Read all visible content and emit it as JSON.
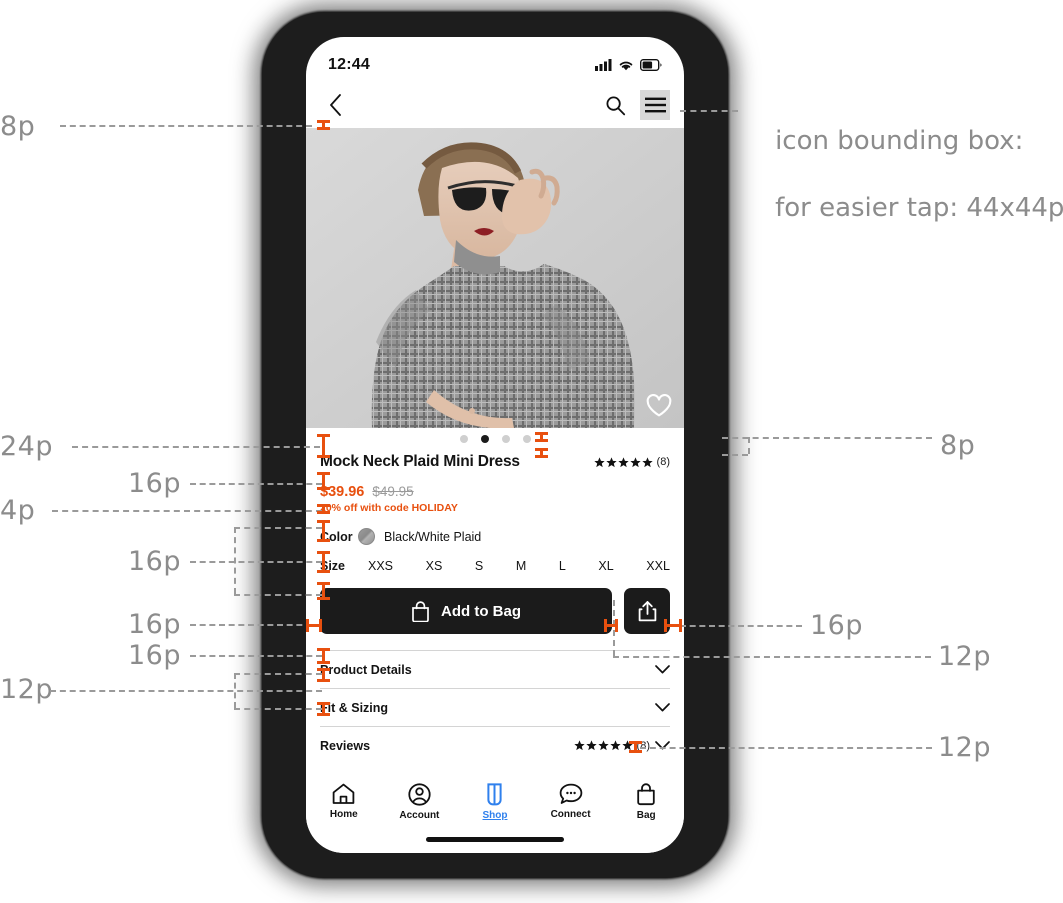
{
  "phone": {
    "status_bar": {
      "time": "12:44",
      "icons": [
        "cellular-signal-icon",
        "wifi-icon",
        "battery-icon"
      ]
    },
    "nav_bar": {
      "back_icon": "chevron-left-icon",
      "search_icon": "search-icon",
      "menu_icon": "hamburger-menu-icon"
    },
    "hero": {
      "favorite_icon": "heart-icon",
      "alt": "Model wearing plaid mock neck mini dress"
    },
    "carousel": {
      "count": 4,
      "active_index": 1
    },
    "product": {
      "title": "Mock Neck Plaid Mini Dress",
      "rating_stars": 5,
      "review_count": "(8)",
      "price_current": "$39.96",
      "price_original": "$49.95",
      "promo": "20% off with code HOLIDAY",
      "color_label": "Color",
      "color_value": "Black/White Plaid",
      "size_label": "Size",
      "sizes": [
        "XXS",
        "XS",
        "S",
        "M",
        "L",
        "XL",
        "XXL"
      ]
    },
    "cta": {
      "add_to_bag_label": "Add to Bag",
      "bag_icon": "shopping-bag-icon",
      "share_icon": "share-icon"
    },
    "accordion": [
      {
        "label": "Product Details",
        "chevron": "chevron-down-icon",
        "has_rating": false
      },
      {
        "label": "Fit & Sizing",
        "chevron": "chevron-down-icon",
        "has_rating": false
      },
      {
        "label": "Reviews",
        "chevron": "chevron-down-icon",
        "has_rating": true,
        "review_count": "(8)"
      }
    ],
    "tab_bar": {
      "active": "Shop",
      "items": [
        {
          "label": "Home",
          "icon": "home-icon"
        },
        {
          "label": "Account",
          "icon": "account-circle-icon"
        },
        {
          "label": "Shop",
          "icon": "dress-icon"
        },
        {
          "label": "Connect",
          "icon": "chat-bubble-icon"
        },
        {
          "label": "Bag",
          "icon": "shopping-bag-icon"
        }
      ]
    }
  },
  "annotations": {
    "left": [
      {
        "id": "a-8p-nav",
        "text": "8p"
      },
      {
        "id": "a-24p",
        "text": "24p"
      },
      {
        "id": "a-16p-title",
        "text": "16p"
      },
      {
        "id": "a-4p",
        "text": "4p"
      },
      {
        "id": "a-16p-color",
        "text": "16p"
      },
      {
        "id": "a-16p-cta",
        "text": "16p"
      },
      {
        "id": "a-16p-acc",
        "text": "16p"
      },
      {
        "id": "a-12p",
        "text": "12p"
      }
    ],
    "right": [
      {
        "id": "b-note",
        "line1": "icon bounding box:",
        "line2": "for easier tap: 44x44p"
      },
      {
        "id": "b-8p",
        "text": "8p"
      },
      {
        "id": "b-16p",
        "text": "16p"
      },
      {
        "id": "b-12p-1",
        "text": "12p"
      },
      {
        "id": "b-12p-2",
        "text": "12p"
      }
    ]
  },
  "colors": {
    "accent_orange": "#E8500F",
    "annotation_gray": "#8c8c8c",
    "dark": "#1b1b1b",
    "link_blue": "#2f80ED"
  }
}
